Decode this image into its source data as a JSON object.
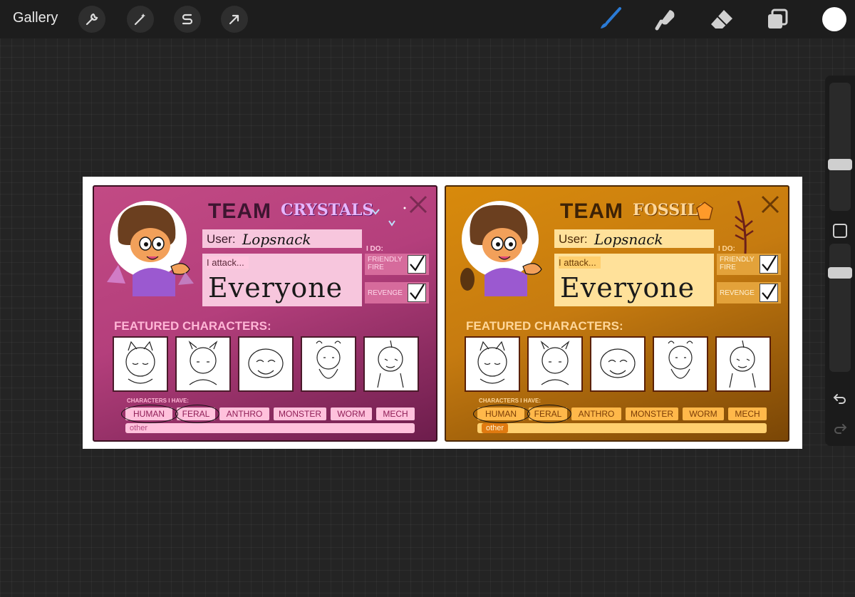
{
  "toolbar": {
    "gallery_label": "Gallery",
    "left_tools": [
      "wrench-icon",
      "magic-wand-icon",
      "selection-s-icon",
      "move-arrow-icon"
    ],
    "right_tools": [
      "brush-icon",
      "smudge-icon",
      "eraser-icon",
      "layers-icon"
    ],
    "active_tool": "brush",
    "accent_color": "#2b7bd6",
    "current_color": "#ffffff"
  },
  "sidebar": {
    "brush_size": 0.35,
    "opacity": 0.8,
    "undo_icon": "undo-icon",
    "redo_icon": "redo-icon"
  },
  "cards": {
    "crystals": {
      "team_word": "TEAM",
      "team_name": "CRYSTALS",
      "user_label": "User:",
      "user_value": "Lopsnack",
      "attack_label": "I attack...",
      "attack_value": "Everyone",
      "ido_label": "I DO:",
      "friendly_fire": "FRIENDLY FIRE",
      "revenge": "REVENGE",
      "featured_label": "FEATURED CHARACTERS:",
      "have_label": "CHARACTERS I HAVE:",
      "chips": [
        "HUMAN",
        "FERAL",
        "ANTHRO",
        "MONSTER",
        "WORM",
        "MECH"
      ],
      "other_label": "other",
      "colors": {
        "panel": "#f7c6dd",
        "label": "#ffc7df",
        "chip": "#ffc1dc",
        "text": "#8e1e56"
      }
    },
    "fossils": {
      "team_word": "TEAM",
      "team_name": "FOSSILS",
      "user_label": "User:",
      "user_value": "Lopsnack",
      "attack_label": "I attack...",
      "attack_value": "Everyone",
      "ido_label": "I DO:",
      "friendly_fire": "FRIENDLY FIRE",
      "revenge": "REVENGE",
      "featured_label": "FEATURED CHARACTERS:",
      "have_label": "CHARACTERS I HAVE:",
      "chips": [
        "HUMAN",
        "FERAL",
        "ANTHRO",
        "MONSTER",
        "WORM",
        "MECH"
      ],
      "other_label": "other",
      "colors": {
        "panel": "#ffe19a",
        "label": "#ffcf6e",
        "chip": "#ffb84a",
        "text": "#7a3c06"
      }
    }
  }
}
